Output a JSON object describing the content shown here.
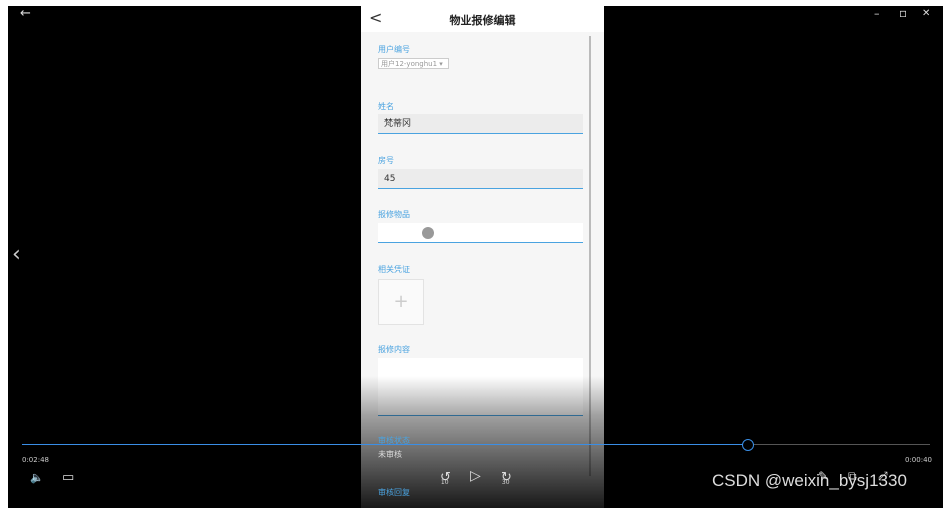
{
  "player": {
    "title_bar": {
      "back_symbol": "←",
      "minimize_symbol": "–",
      "restore_symbol": "▫",
      "close_symbol": "✕"
    },
    "left_nav_symbol": "‹",
    "time_current": "0:02:48",
    "time_remaining": "0:00:40",
    "progress_fraction": 0.8,
    "controls": {
      "volume_symbol": "🔈",
      "subtitle_symbol": "▭",
      "rewind_symbol": "↺",
      "rewind_seconds": "10",
      "play_symbol": "▷",
      "forward_symbol": "↻",
      "forward_seconds": "30",
      "edit_symbol": "✎",
      "pip_symbol": "⧉",
      "fullscreen_symbol": "⤢"
    },
    "accent_color": "#3a8ee6"
  },
  "phone": {
    "back_symbol": "<",
    "title": "物业报修编辑",
    "fields": {
      "user_id_label": "用户编号",
      "user_id_value": "用户12-yonghu1 ▾",
      "name_label": "姓名",
      "name_value": "梵蒂冈",
      "room_label": "房号",
      "room_value": "45",
      "item_label": "报修物品",
      "proof_label": "相关凭证",
      "upload_symbol": "+",
      "content_label": "报修内容",
      "status_label": "审核状态",
      "status_value": "未审核",
      "reply_label": "审核回复"
    },
    "label_color": "#4aa3e0"
  },
  "watermark": "CSDN @weixin_bysj1330"
}
